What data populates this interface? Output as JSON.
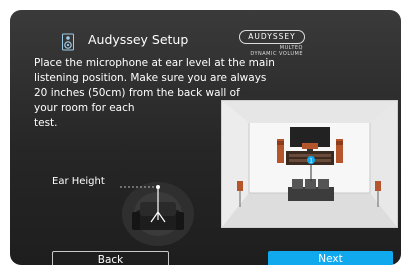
{
  "header": {
    "title": "Audyssey Setup",
    "icon": "speaker-setup-icon"
  },
  "brand": {
    "name": "AUDYSSEY",
    "line1": "MULTEQ",
    "line2": "DYNAMIC VOLUME"
  },
  "instructions": [
    "Place the microphone at ear level at the main",
    "listening position. Make sure you are always",
    "20 inches (50cm) from the back wall of",
    "your room for each",
    "test."
  ],
  "ear_height": {
    "label": "Ear Height"
  },
  "room": {
    "marker": "1"
  },
  "buttons": {
    "back": "Back",
    "next": "Next"
  },
  "colors": {
    "accent": "#10a9ee",
    "background": "#262626"
  }
}
